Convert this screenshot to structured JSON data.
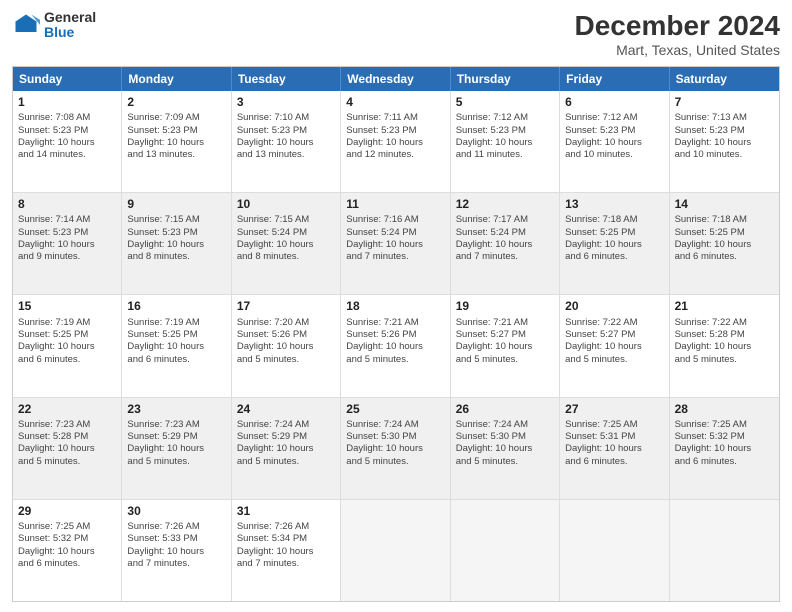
{
  "logo": {
    "general": "General",
    "blue": "Blue"
  },
  "title": "December 2024",
  "subtitle": "Mart, Texas, United States",
  "header_days": [
    "Sunday",
    "Monday",
    "Tuesday",
    "Wednesday",
    "Thursday",
    "Friday",
    "Saturday"
  ],
  "weeks": [
    [
      {
        "day": "1",
        "text": "Sunrise: 7:08 AM\nSunset: 5:23 PM\nDaylight: 10 hours\nand 14 minutes."
      },
      {
        "day": "2",
        "text": "Sunrise: 7:09 AM\nSunset: 5:23 PM\nDaylight: 10 hours\nand 13 minutes."
      },
      {
        "day": "3",
        "text": "Sunrise: 7:10 AM\nSunset: 5:23 PM\nDaylight: 10 hours\nand 13 minutes."
      },
      {
        "day": "4",
        "text": "Sunrise: 7:11 AM\nSunset: 5:23 PM\nDaylight: 10 hours\nand 12 minutes."
      },
      {
        "day": "5",
        "text": "Sunrise: 7:12 AM\nSunset: 5:23 PM\nDaylight: 10 hours\nand 11 minutes."
      },
      {
        "day": "6",
        "text": "Sunrise: 7:12 AM\nSunset: 5:23 PM\nDaylight: 10 hours\nand 10 minutes."
      },
      {
        "day": "7",
        "text": "Sunrise: 7:13 AM\nSunset: 5:23 PM\nDaylight: 10 hours\nand 10 minutes."
      }
    ],
    [
      {
        "day": "8",
        "text": "Sunrise: 7:14 AM\nSunset: 5:23 PM\nDaylight: 10 hours\nand 9 minutes."
      },
      {
        "day": "9",
        "text": "Sunrise: 7:15 AM\nSunset: 5:23 PM\nDaylight: 10 hours\nand 8 minutes."
      },
      {
        "day": "10",
        "text": "Sunrise: 7:15 AM\nSunset: 5:24 PM\nDaylight: 10 hours\nand 8 minutes."
      },
      {
        "day": "11",
        "text": "Sunrise: 7:16 AM\nSunset: 5:24 PM\nDaylight: 10 hours\nand 7 minutes."
      },
      {
        "day": "12",
        "text": "Sunrise: 7:17 AM\nSunset: 5:24 PM\nDaylight: 10 hours\nand 7 minutes."
      },
      {
        "day": "13",
        "text": "Sunrise: 7:18 AM\nSunset: 5:25 PM\nDaylight: 10 hours\nand 6 minutes."
      },
      {
        "day": "14",
        "text": "Sunrise: 7:18 AM\nSunset: 5:25 PM\nDaylight: 10 hours\nand 6 minutes."
      }
    ],
    [
      {
        "day": "15",
        "text": "Sunrise: 7:19 AM\nSunset: 5:25 PM\nDaylight: 10 hours\nand 6 minutes."
      },
      {
        "day": "16",
        "text": "Sunrise: 7:19 AM\nSunset: 5:25 PM\nDaylight: 10 hours\nand 6 minutes."
      },
      {
        "day": "17",
        "text": "Sunrise: 7:20 AM\nSunset: 5:26 PM\nDaylight: 10 hours\nand 5 minutes."
      },
      {
        "day": "18",
        "text": "Sunrise: 7:21 AM\nSunset: 5:26 PM\nDaylight: 10 hours\nand 5 minutes."
      },
      {
        "day": "19",
        "text": "Sunrise: 7:21 AM\nSunset: 5:27 PM\nDaylight: 10 hours\nand 5 minutes."
      },
      {
        "day": "20",
        "text": "Sunrise: 7:22 AM\nSunset: 5:27 PM\nDaylight: 10 hours\nand 5 minutes."
      },
      {
        "day": "21",
        "text": "Sunrise: 7:22 AM\nSunset: 5:28 PM\nDaylight: 10 hours\nand 5 minutes."
      }
    ],
    [
      {
        "day": "22",
        "text": "Sunrise: 7:23 AM\nSunset: 5:28 PM\nDaylight: 10 hours\nand 5 minutes."
      },
      {
        "day": "23",
        "text": "Sunrise: 7:23 AM\nSunset: 5:29 PM\nDaylight: 10 hours\nand 5 minutes."
      },
      {
        "day": "24",
        "text": "Sunrise: 7:24 AM\nSunset: 5:29 PM\nDaylight: 10 hours\nand 5 minutes."
      },
      {
        "day": "25",
        "text": "Sunrise: 7:24 AM\nSunset: 5:30 PM\nDaylight: 10 hours\nand 5 minutes."
      },
      {
        "day": "26",
        "text": "Sunrise: 7:24 AM\nSunset: 5:30 PM\nDaylight: 10 hours\nand 5 minutes."
      },
      {
        "day": "27",
        "text": "Sunrise: 7:25 AM\nSunset: 5:31 PM\nDaylight: 10 hours\nand 6 minutes."
      },
      {
        "day": "28",
        "text": "Sunrise: 7:25 AM\nSunset: 5:32 PM\nDaylight: 10 hours\nand 6 minutes."
      }
    ],
    [
      {
        "day": "29",
        "text": "Sunrise: 7:25 AM\nSunset: 5:32 PM\nDaylight: 10 hours\nand 6 minutes."
      },
      {
        "day": "30",
        "text": "Sunrise: 7:26 AM\nSunset: 5:33 PM\nDaylight: 10 hours\nand 7 minutes."
      },
      {
        "day": "31",
        "text": "Sunrise: 7:26 AM\nSunset: 5:34 PM\nDaylight: 10 hours\nand 7 minutes."
      },
      {
        "day": "",
        "text": ""
      },
      {
        "day": "",
        "text": ""
      },
      {
        "day": "",
        "text": ""
      },
      {
        "day": "",
        "text": ""
      }
    ]
  ]
}
